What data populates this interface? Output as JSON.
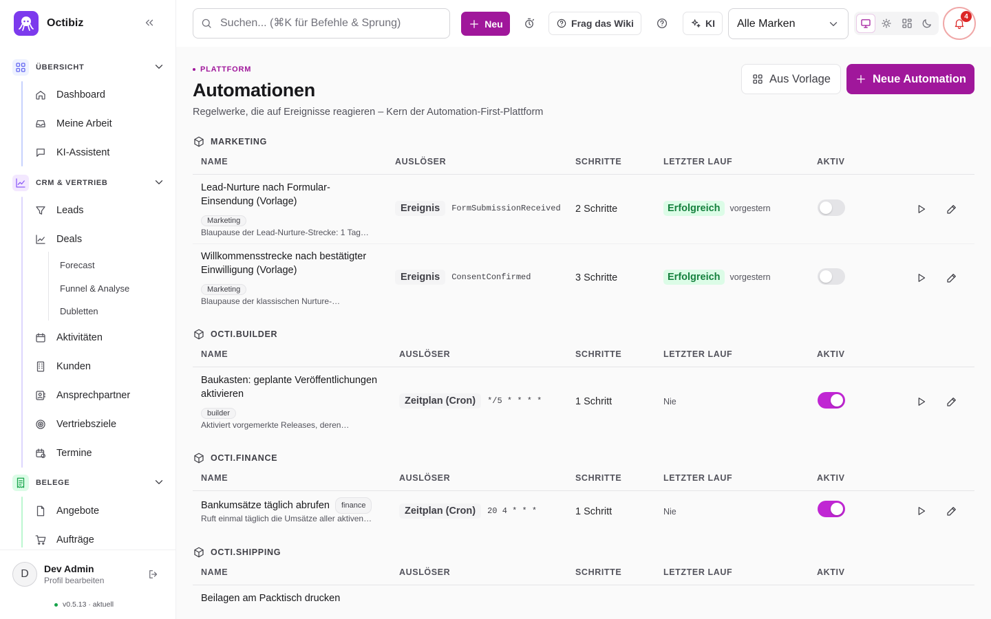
{
  "app": {
    "name": "Octibiz"
  },
  "sidebar": {
    "sections": [
      {
        "label": "ÜBERSICHT",
        "icon": "grid-icon",
        "color": "#6366f1"
      },
      {
        "label": "CRM & VERTRIEB",
        "icon": "chart-line-icon",
        "color": "#8b5cf6"
      },
      {
        "label": "BELEGE",
        "icon": "receipt-icon",
        "color": "#16a34a"
      }
    ],
    "items": [
      {
        "label": "Dashboard",
        "icon": "home-icon"
      },
      {
        "label": "Meine Arbeit",
        "icon": "inbox-icon"
      },
      {
        "label": "KI-Assistent",
        "icon": "chat-icon"
      },
      {
        "label": "Leads",
        "icon": "funnel-icon"
      },
      {
        "label": "Deals",
        "icon": "chart-icon"
      },
      {
        "label": "Aktivitäten",
        "icon": "calendar-icon"
      },
      {
        "label": "Kunden",
        "icon": "building-icon"
      },
      {
        "label": "Ansprechpartner",
        "icon": "contact-icon"
      },
      {
        "label": "Vertriebsziele",
        "icon": "target-icon"
      },
      {
        "label": "Termine",
        "icon": "calendar-clock-icon"
      },
      {
        "label": "Angebote",
        "icon": "file-icon"
      },
      {
        "label": "Aufträge",
        "icon": "cart-icon"
      }
    ],
    "subitems": [
      "Forecast",
      "Funnel & Analyse",
      "Dubletten"
    ],
    "user": {
      "initial": "D",
      "name": "Dev Admin",
      "sub": "Profil bearbeiten"
    },
    "version": "v0.5.13 · aktuell"
  },
  "topbar": {
    "search_placeholder": "Suchen... (⌘K für Befehle & Sprung)",
    "new_label": "Neu",
    "wiki_label": "Frag das Wiki",
    "ai_label": "KI",
    "brand_select": "Alle Marken",
    "notifications": "4"
  },
  "page": {
    "eyebrow": "PLATTFORM",
    "title": "Automationen",
    "subtitle": "Regelwerke, die auf Ereignisse reagieren – Kern der Automation-First-Plattform",
    "btn_template": "Aus Vorlage",
    "btn_new": "Neue Automation"
  },
  "columns": {
    "name": "NAME",
    "trigger": "AUSLÖSER",
    "steps": "SCHRITTE",
    "last_run": "LETZTER LAUF",
    "active": "AKTIV"
  },
  "groups": [
    {
      "label": "MARKETING",
      "rows": [
        {
          "name": "Lead-Nurture nach Formular-Einsendung (Vorlage)",
          "tag": "Marketing",
          "desc": "Blaupause der Lead-Nurture-Strecke: 1 Tag…",
          "trigger": "Ereignis",
          "code": "FormSubmissionReceived",
          "steps": "2 Schritte",
          "status": "Erfolgreich",
          "when": "vorgestern",
          "active": false
        },
        {
          "name": "Willkommensstrecke nach bestätigter Einwilligung (Vorlage)",
          "tag": "Marketing",
          "desc": "Blaupause der klassischen Nurture-…",
          "trigger": "Ereignis",
          "code": "ConsentConfirmed",
          "steps": "3 Schritte",
          "status": "Erfolgreich",
          "when": "vorgestern",
          "active": false
        }
      ]
    },
    {
      "label": "OCTI.BUILDER",
      "rows": [
        {
          "name": "Baukasten: geplante Veröffentlichungen aktivieren",
          "tag": "builder",
          "desc": "Aktiviert vorgemerkte Releases, deren…",
          "trigger": "Zeitplan (Cron)",
          "code": "*/5 * * * *",
          "steps": "1 Schritt",
          "status": "",
          "when": "Nie",
          "active": true
        }
      ]
    },
    {
      "label": "OCTI.FINANCE",
      "rows": [
        {
          "name": "Bankumsätze täglich abrufen",
          "tag": "finance",
          "desc": "Ruft einmal täglich die Umsätze aller aktiven…",
          "trigger": "Zeitplan (Cron)",
          "code": "20 4 * * *",
          "steps": "1 Schritt",
          "status": "",
          "when": "Nie",
          "active": true
        }
      ]
    },
    {
      "label": "OCTI.SHIPPING",
      "rows": [
        {
          "name": "Beilagen am Packtisch drucken"
        }
      ]
    }
  ]
}
